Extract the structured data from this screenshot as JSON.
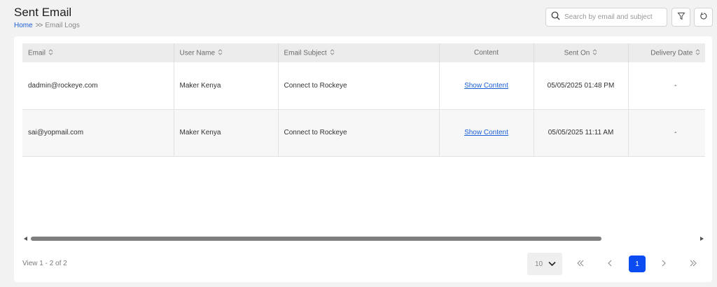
{
  "header": {
    "title": "Sent Email",
    "breadcrumb": {
      "home": "Home",
      "separator": ">>",
      "current": "Email Logs"
    }
  },
  "toolbar": {
    "search_placeholder": "Search by email and subject",
    "icons": {
      "search": "search-icon",
      "filter": "filter-icon",
      "refresh": "refresh-icon"
    }
  },
  "table": {
    "columns": [
      "Email",
      "User Name",
      "Email Subject",
      "Content",
      "Sent On",
      "Delivery Date"
    ],
    "rows": [
      {
        "email": "dadmin@rockeye.com",
        "user_name": "Maker Kenya",
        "subject": "Connect to Rockeye",
        "content": "Show Content",
        "sent_on": "05/05/2025 01:48 PM",
        "delivery_date": "-"
      },
      {
        "email": "sai@yopmail.com",
        "user_name": "Maker Kenya",
        "subject": "Connect to Rockeye",
        "content": "Show Content",
        "sent_on": "05/05/2025 11:11 AM",
        "delivery_date": "-"
      }
    ]
  },
  "footer": {
    "view_count": "View 1 - 2 of 2",
    "page_size": "10",
    "current_page": "1"
  },
  "colors": {
    "accent": "#0a4cf2",
    "link": "#1a5fd6"
  }
}
